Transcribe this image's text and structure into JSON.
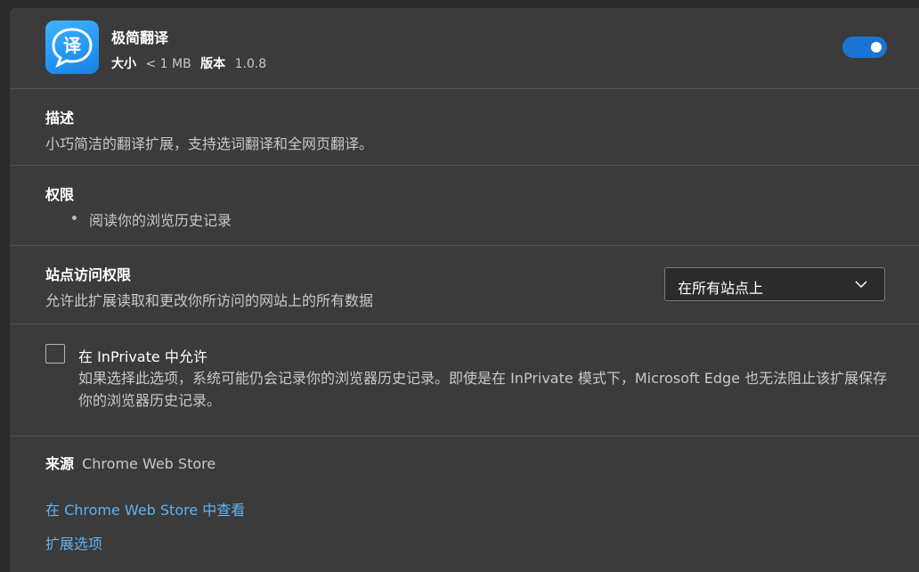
{
  "extension": {
    "name": "极简翻译",
    "icon": "translate-chat-icon",
    "icon_glyph": "译",
    "size_label": "大小",
    "size_value": "< 1 MB",
    "version_label": "版本",
    "version_value": "1.0.8",
    "enabled": true
  },
  "description": {
    "title": "描述",
    "text": "小巧简洁的翻译扩展，支持选词翻译和全网页翻译。"
  },
  "permissions": {
    "title": "权限",
    "items": [
      "阅读你的浏览历史记录"
    ]
  },
  "site_access": {
    "title": "站点访问权限",
    "text": "允许此扩展读取和更改你所访问的网站上的所有数据",
    "selected": "在所有站点上"
  },
  "inprivate": {
    "label": "在 InPrivate 中允许",
    "checked": false,
    "description": "如果选择此选项，系统可能仍会记录你的浏览器历史记录。即使是在 InPrivate 模式下，Microsoft Edge 也无法阻止该扩展保存你的浏览器历史记录。"
  },
  "source": {
    "label": "来源",
    "value": "Chrome Web Store"
  },
  "links": {
    "view_in_store": "在 Chrome Web Store 中查看",
    "extension_options": "扩展选项"
  },
  "colors": {
    "background": "#2b2b2b",
    "card": "#3b3b3b",
    "accent": "#1b74d4",
    "link": "#5fb2f2"
  }
}
